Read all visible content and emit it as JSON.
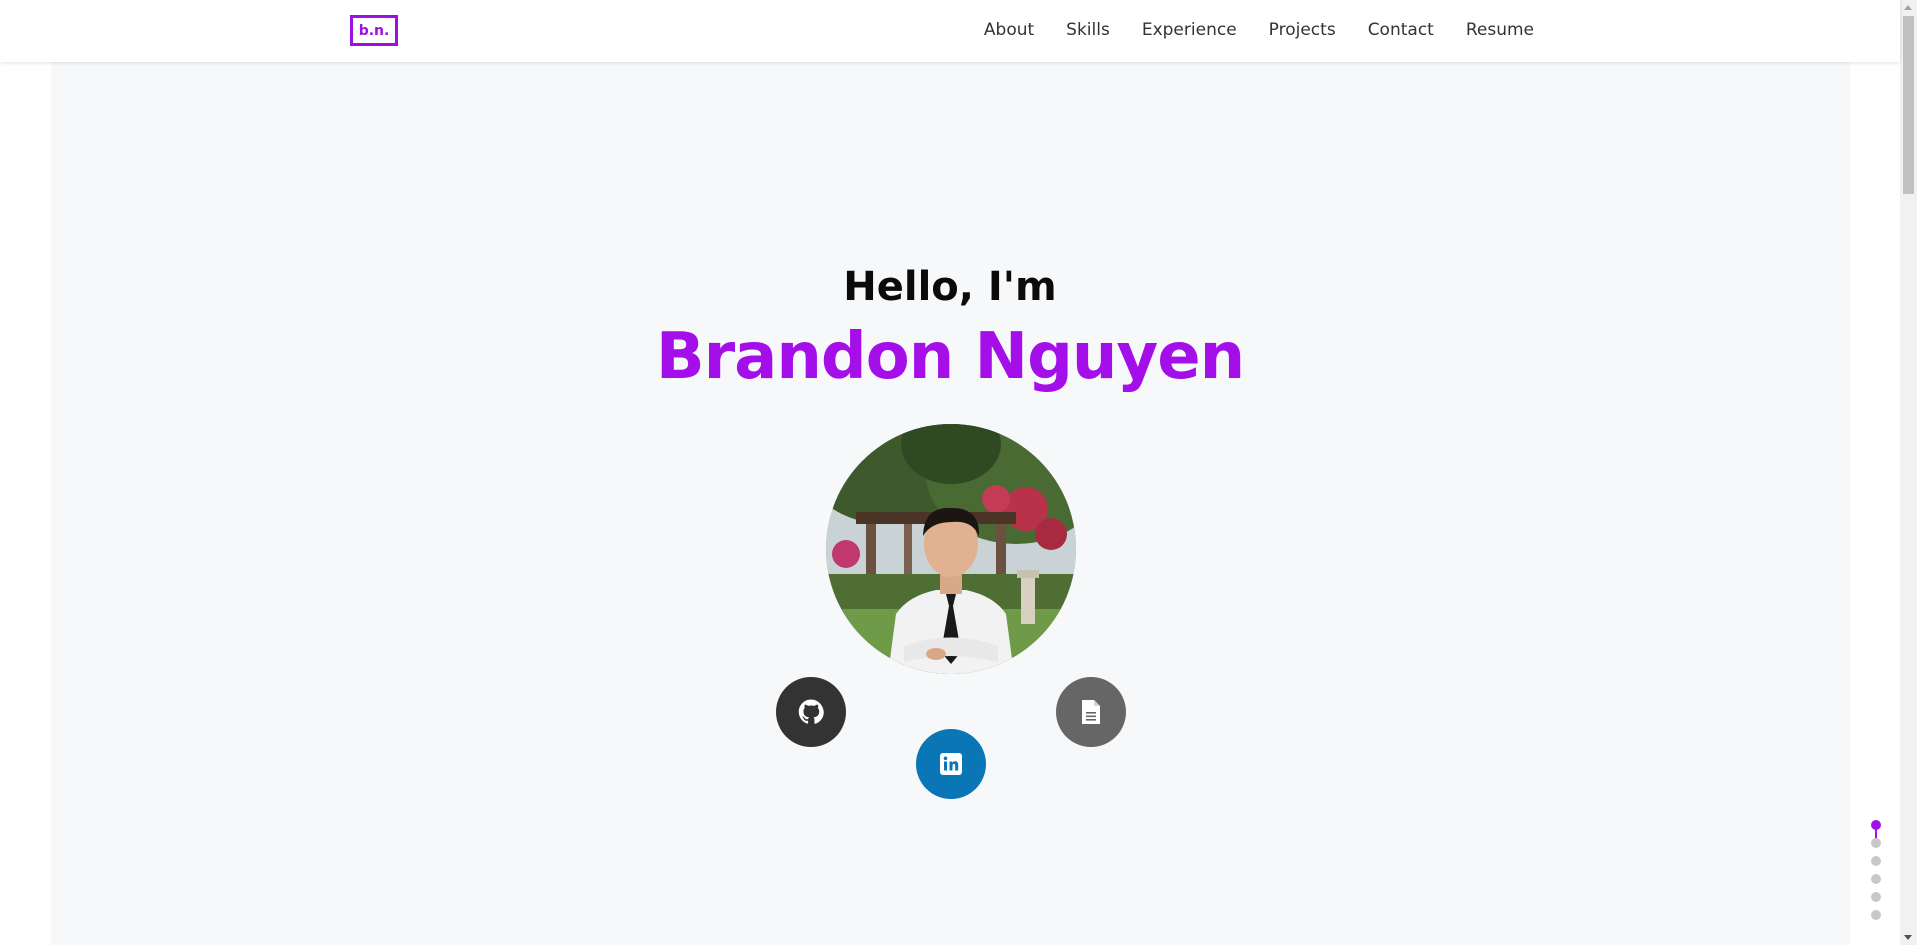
{
  "nav": {
    "logo_text": "b.n.",
    "links": [
      "About",
      "Skills",
      "Experience",
      "Projects",
      "Contact",
      "Resume"
    ]
  },
  "hero": {
    "greeting": "Hello, I'm",
    "name": "Brandon Nguyen"
  },
  "social": {
    "github_icon": "github-icon",
    "linkedin_icon": "linkedin-icon",
    "resume_icon": "document-icon"
  },
  "section_nav": {
    "count": 6,
    "active_index": 0
  },
  "colors": {
    "accent": "#a40ee8",
    "github_bg": "#333333",
    "linkedin_bg": "#0a76b5",
    "resume_bg": "#666666",
    "hero_bg": "#f7f8fa"
  }
}
